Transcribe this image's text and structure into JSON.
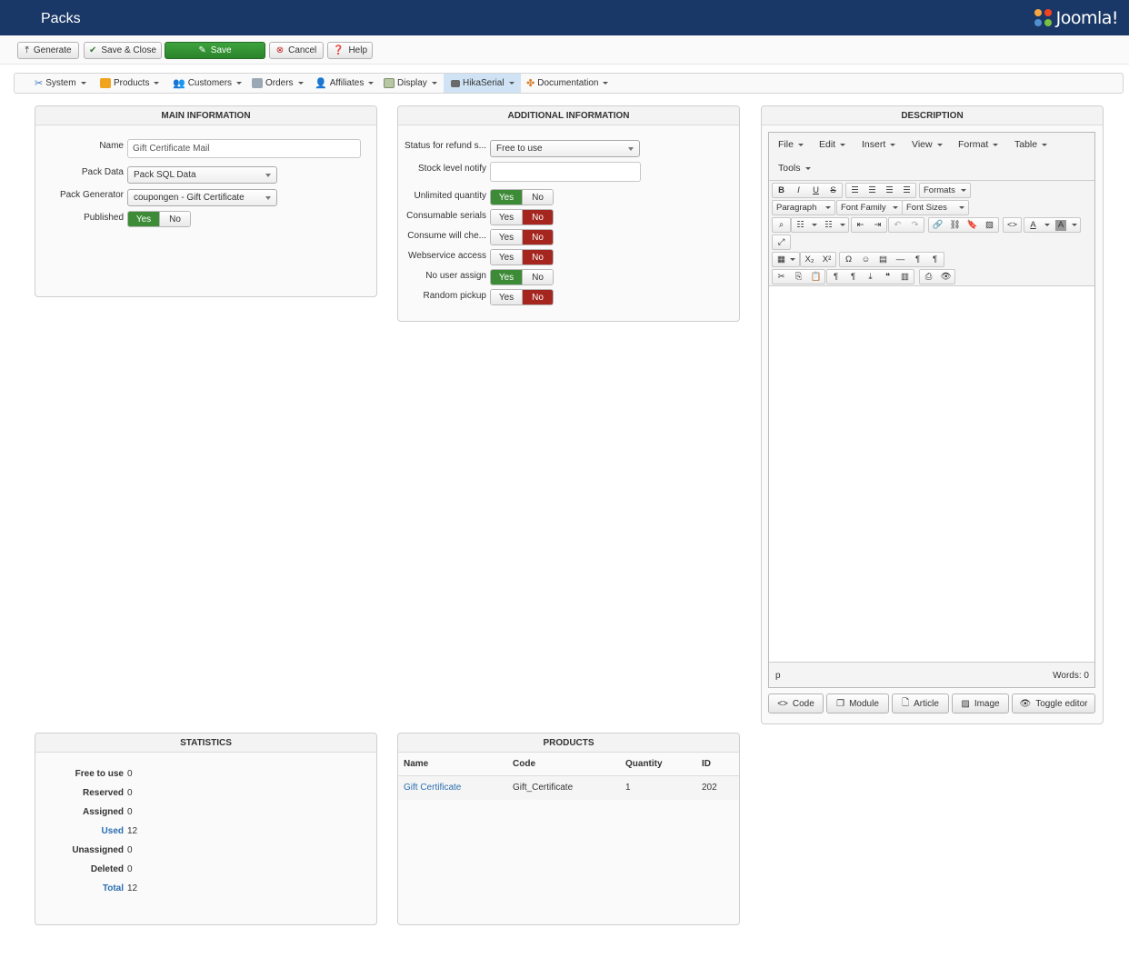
{
  "header": {
    "title": "Packs",
    "logo_text": "Joomla!"
  },
  "toolbar": {
    "generate": "Generate",
    "save_close": "Save & Close",
    "save": "Save",
    "cancel": "Cancel",
    "help": "Help"
  },
  "menu": {
    "system": "System",
    "products": "Products",
    "customers": "Customers",
    "orders": "Orders",
    "affiliates": "Affiliates",
    "display": "Display",
    "hikaserial": "HikaSerial",
    "documentation": "Documentation"
  },
  "main_info": {
    "title": "MAIN INFORMATION",
    "name_label": "Name",
    "name_value": "Gift Certificate Mail",
    "pack_data_label": "Pack Data",
    "pack_data_value": "Pack SQL Data",
    "pack_generator_label": "Pack Generator",
    "pack_generator_value": "coupongen - Gift Certificate",
    "published_label": "Published",
    "yes": "Yes",
    "no": "No"
  },
  "additional": {
    "title": "ADDITIONAL INFORMATION",
    "status_refund_label": "Status for refund s...",
    "status_refund_value": "Free to use",
    "stock_notify_label": "Stock level notify",
    "stock_notify_value": "",
    "rows": [
      {
        "label": "Unlimited quantity",
        "value": "yes"
      },
      {
        "label": "Consumable serials",
        "value": "no"
      },
      {
        "label": "Consume will che...",
        "value": "no"
      },
      {
        "label": "Webservice access",
        "value": "no"
      },
      {
        "label": "No user assign",
        "value": "yes"
      },
      {
        "label": "Random pickup",
        "value": "no"
      }
    ],
    "yes": "Yes",
    "no": "No"
  },
  "description": {
    "title": "DESCRIPTION",
    "menus": [
      "File",
      "Edit",
      "Insert",
      "View",
      "Format",
      "Table",
      "Tools"
    ],
    "formats": "Formats",
    "paragraph": "Paragraph",
    "font_family": "Font Family",
    "font_sizes": "Font Sizes",
    "status_path": "p",
    "word_count": "Words: 0",
    "buttons": {
      "code": "Code",
      "module": "Module",
      "article": "Article",
      "image": "Image",
      "toggle": "Toggle editor"
    }
  },
  "statistics": {
    "title": "STATISTICS",
    "rows": [
      {
        "label": "Free to use",
        "value": "0",
        "link": false
      },
      {
        "label": "Reserved",
        "value": "0",
        "link": false
      },
      {
        "label": "Assigned",
        "value": "0",
        "link": false
      },
      {
        "label": "Used",
        "value": "12",
        "link": true
      },
      {
        "label": "Unassigned",
        "value": "0",
        "link": false
      },
      {
        "label": "Deleted",
        "value": "0",
        "link": false
      },
      {
        "label": "Total",
        "value": "12",
        "link": true
      }
    ]
  },
  "products": {
    "title": "PRODUCTS",
    "columns": [
      "Name",
      "Code",
      "Quantity",
      "ID"
    ],
    "rows": [
      {
        "name": "Gift Certificate",
        "code": "Gift_Certificate",
        "quantity": "1",
        "id": "202"
      }
    ]
  },
  "colors": {
    "header_bg": "#1a3867",
    "yes_active": "#3d8b37",
    "no_active": "#a4261f",
    "link": "#2a6eb0",
    "save_green": "#2c832c"
  }
}
